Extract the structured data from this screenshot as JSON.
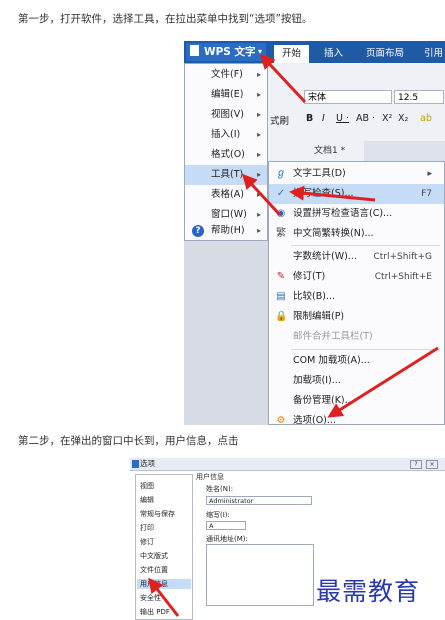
{
  "steps": {
    "step1": "第一步，打开软件，选择工具，在拉出菜单中找到“选项”按钮。",
    "step2": "第二步，在弹出的窗口中长到，用户信息，点击"
  },
  "screenshot1": {
    "app_button": "WPS 文字",
    "tabs": [
      "开始",
      "插入",
      "页面布局",
      "引用"
    ],
    "font_name": "宋体",
    "font_size": "12.5",
    "format_painter": "式刷",
    "format_buttons": [
      "B",
      "I",
      "U ·",
      "AB ·",
      "X²",
      "X₂"
    ],
    "doc_tab": "文档1 *",
    "close_glyph": "×",
    "app_menu": {
      "items": [
        {
          "label": "文件(F)"
        },
        {
          "label": "编辑(E)"
        },
        {
          "label": "视图(V)"
        },
        {
          "label": "插入(I)"
        },
        {
          "label": "格式(O)"
        },
        {
          "label": "工具(T)"
        },
        {
          "label": "表格(A)"
        },
        {
          "label": "窗口(W)"
        },
        {
          "label": "帮助(H)"
        }
      ],
      "highlighted": "工具(T)"
    },
    "tools_menu": {
      "items": [
        {
          "label": "文字工具(D)",
          "shortcut": ""
        },
        {
          "label": "拼写检查(S)...",
          "shortcut": "F7"
        },
        {
          "label": "设置拼写检查语言(C)...",
          "shortcut": ""
        },
        {
          "label": "中文简繁转换(N)...",
          "shortcut": ""
        },
        {
          "label": "字数统计(W)...",
          "shortcut": "Ctrl+Shift+G"
        },
        {
          "label": "修订(T)",
          "shortcut": "Ctrl+Shift+E"
        },
        {
          "label": "比较(B)...",
          "shortcut": ""
        },
        {
          "label": "限制编辑(P)",
          "shortcut": ""
        },
        {
          "label": "邮件合并工具栏(T)",
          "shortcut": ""
        },
        {
          "label": "COM 加载项(A)...",
          "shortcut": ""
        },
        {
          "label": "加载项(I)...",
          "shortcut": ""
        },
        {
          "label": "备份管理(K)...",
          "shortcut": ""
        },
        {
          "label": "选项(O)...",
          "shortcut": ""
        }
      ]
    }
  },
  "screenshot2": {
    "dialog_title": "选项",
    "categories": [
      "视图",
      "编辑",
      "常规与保存",
      "打印",
      "修订",
      "中文版式",
      "文件位置",
      "用户信息",
      "安全性",
      "输出 PDF"
    ],
    "selected_category": "用户信息",
    "group_title": "用户信息",
    "name_label": "姓名(N):",
    "name_value": "Administrator",
    "initials_label": "缩写(I):",
    "initials_value": "A",
    "address_label": "通讯地址(M):"
  },
  "watermark": "最需教育",
  "colors": {
    "accent": "#1f5aa6",
    "highlight": "#c6dbf6",
    "arrow": "#e02020",
    "watermark": "#2838b0"
  }
}
